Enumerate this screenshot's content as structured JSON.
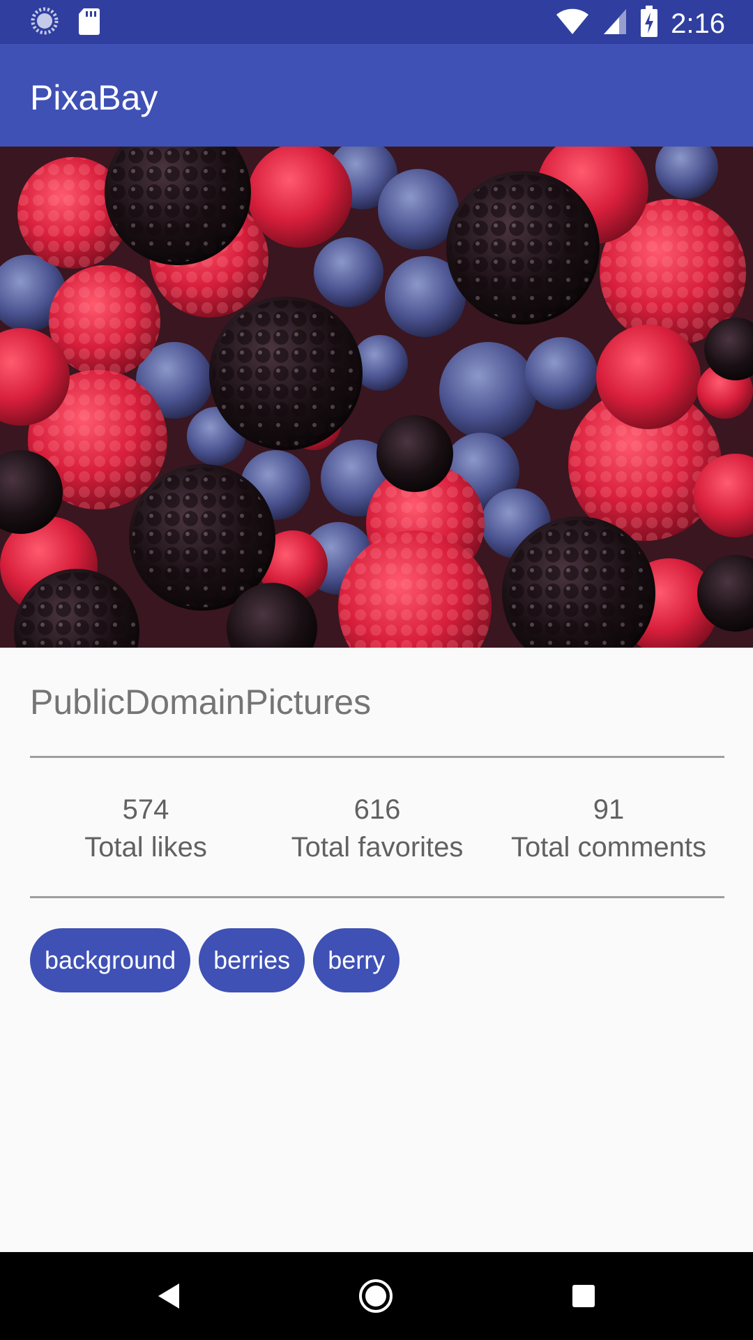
{
  "status_bar": {
    "time": "2:16",
    "left_icons": [
      "sync-icon",
      "sd-card-icon"
    ],
    "right_icons": [
      "wifi-icon",
      "signal-icon",
      "battery-charging-icon"
    ]
  },
  "app_bar": {
    "title": "PixaBay"
  },
  "photo": {
    "description_icon": "berries-photo"
  },
  "author": {
    "name": "PublicDomainPictures"
  },
  "stats": [
    {
      "value": "574",
      "label": "Total likes"
    },
    {
      "value": "616",
      "label": "Total favorites"
    },
    {
      "value": "91",
      "label": "Total comments"
    }
  ],
  "tags": [
    "background",
    "berries",
    "berry"
  ],
  "colors": {
    "status_bar": "#303F9F",
    "primary": "#3F51B5",
    "background": "#FAFAFA",
    "text_secondary": "#757575"
  },
  "nav_bar": {
    "buttons": [
      "back-icon",
      "home-icon",
      "recents-icon"
    ]
  }
}
